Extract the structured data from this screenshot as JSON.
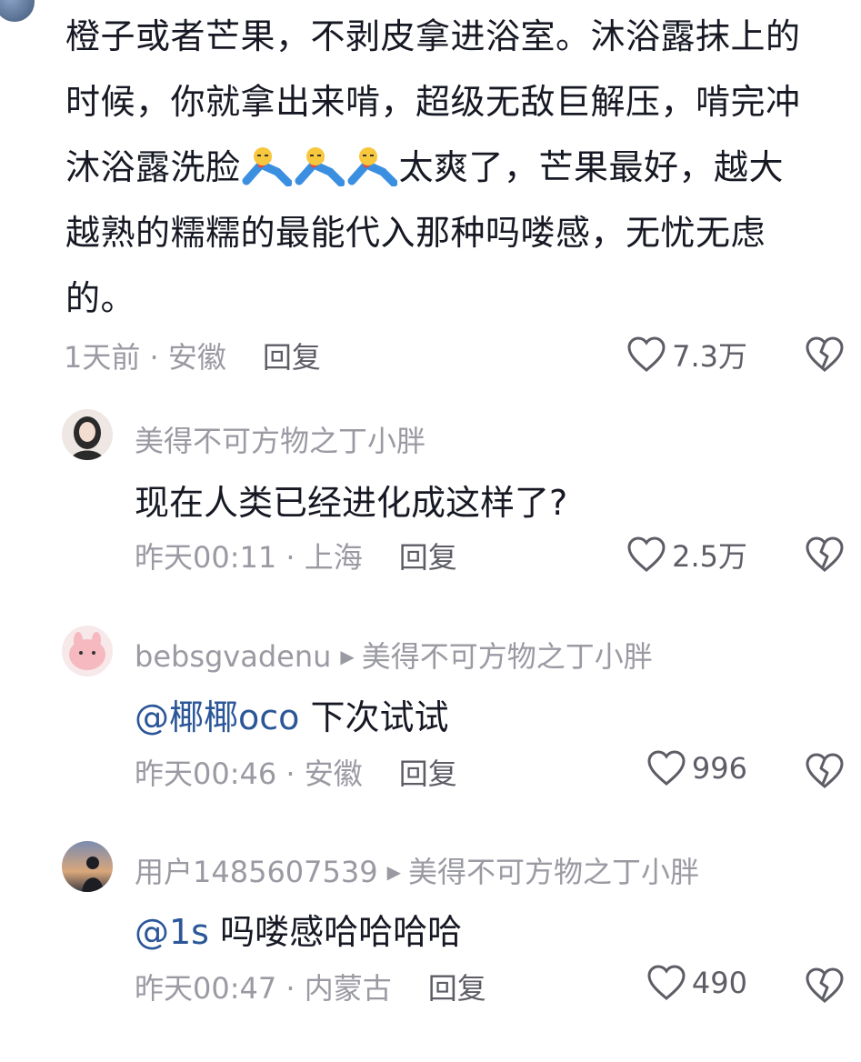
{
  "top_comment": {
    "text_lines": [
      "橙子或者芒果，不剥皮拿进浴室。沐浴露抹上的",
      "时候，你就拿出来啃，超级无敌巨解压，啃完冲",
      "沐浴露洗脸",
      "太爽了，芒果最好，越大",
      "越熟的糯糯的最能代入那种吗喽感，无忧无虑",
      "的。"
    ],
    "time": "1天前",
    "location": "安徽",
    "reply_label": "回复",
    "likes": "7.3万"
  },
  "replies": [
    {
      "username": "美得不可方物之丁小胖",
      "reply_to": "",
      "mention": "",
      "text": "现在人类已经进化成这样了?",
      "time": "昨天00:11",
      "location": "上海",
      "reply_label": "回复",
      "likes": "2.5万"
    },
    {
      "username": "bebsgvadenu",
      "reply_to": "美得不可方物之丁小胖",
      "mention": "@椰椰oco",
      "text": " 下次试试",
      "time": "昨天00:46",
      "location": "安徽",
      "reply_label": "回复",
      "likes": "996"
    },
    {
      "username": "用户1485607539",
      "reply_to": "美得不可方物之丁小胖",
      "mention": "@1s",
      "text": " 吗喽感哈哈哈哈",
      "time": "昨天00:47",
      "location": "内蒙古",
      "reply_label": "回复",
      "likes": "490"
    }
  ],
  "separator": " · ",
  "icons": {
    "like": "heart-outline-icon",
    "dislike": "broken-heart-icon",
    "emoji": "lying-flat-emoji",
    "reply_arrow": "right-triangle-icon"
  },
  "colors": {
    "text": "#161823",
    "meta": "#9a9aa3",
    "mention": "#2b5697"
  }
}
